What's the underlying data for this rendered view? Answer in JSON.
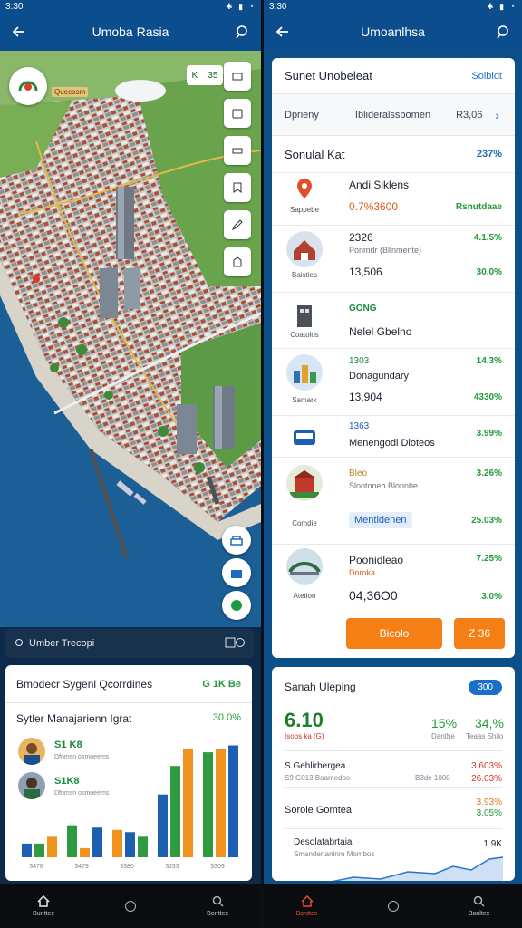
{
  "status": {
    "time_left": "3:30",
    "time_right": "3:30",
    "icons": "✱ ▮ ◔"
  },
  "left": {
    "appbar_title": "Umoba Rasia",
    "map_label": "Quecosm",
    "scale_tag": {
      "a": "K",
      "b": "35"
    },
    "search_text": "Umber Trecopi",
    "card": {
      "title": "Bmodecr Sygenl Qcorrdines",
      "badge": "G 1K Be",
      "subtitle": "Sytler Manajarienn Igrat",
      "subtitle_value": "30.0%",
      "people": [
        {
          "name": "S1 K8",
          "sub": "Dfnmsn osmoeems"
        },
        {
          "name": "S1K8",
          "sub": "Dfnmsn osmoeems"
        }
      ],
      "xticks": [
        "3478",
        "3479",
        "3380",
        "3J33",
        "3309"
      ]
    },
    "nav": {
      "home": "Bunttex",
      "search": "Bonttex"
    }
  },
  "right": {
    "appbar_title": "Umoanlhsa",
    "panel": {
      "title": "Sunet Unobeleat",
      "title_link": "Solbidt",
      "filter_a": "Dprieny",
      "filter_b": "Iblideralssbomen",
      "filter_c": "R3,06",
      "section": "Sonulal Kat",
      "section_pct": "237%",
      "rows": [
        {
          "cap": "Sappebe",
          "l1": "Andi Siklens",
          "l2": "",
          "l3": "0.7%3600",
          "r1": "",
          "r2": "Rsnutdaae"
        },
        {
          "cap": "Baisties",
          "l1": "2326",
          "l2": "Ponmdr (Bllnmente)",
          "l3": "13,506",
          "r1": "4.1.5%",
          "r2": "30.0%"
        },
        {
          "cap": "Coatolos",
          "l1": "GONG",
          "l2": "",
          "l3": "Nelel Gbelno",
          "r1": "",
          "r2": ""
        },
        {
          "cap": "Samark",
          "l1": "1303",
          "l2": "Donagundary",
          "l3": "13,904",
          "r1": "14.3%",
          "r2": "4330%"
        },
        {
          "cap": "",
          "l1": "1363",
          "l2": "",
          "l3": "Menengodl Dioteos",
          "r1": "3.99%",
          "r2": ""
        },
        {
          "cap": "Comdie",
          "l1": "Bleo",
          "l2": "Slootoneb Blonnbe",
          "l3": "Mentldenen",
          "r1": "3.26%",
          "r2": "25.03%"
        },
        {
          "cap": "Atetion",
          "l1": "Poonidleao",
          "l2": "Doroka",
          "l3": "04,36O0",
          "r1": "7.25%",
          "r2": "3.0%"
        }
      ],
      "btn1": "Bicolo",
      "btn2": "Z 36"
    },
    "card": {
      "title": "Sanah Uleping",
      "pill": "300",
      "big": "6.10",
      "big_sub": "Isobs ka (G)",
      "v1": "15%",
      "v1_sub": "Danthe",
      "v2": "34,%",
      "v2_sub": "Teaas Shilo",
      "l1": "S Gehlirbergea",
      "l1_sub": "S9 G013 Boamedos",
      "l1_mid": "B3de 1000",
      "l1_r1": "3.603%",
      "l1_r2": "26.03%",
      "l2": "Sorole Gomtea",
      "l2_r1": "3.93%",
      "l2_r2": "3.05%",
      "l3": "Desolatabrtaia",
      "l3_sub": "Smandertaninm Mombos",
      "l3_r": "1 9K"
    },
    "nav": {
      "home": "Bonttex",
      "search": "Banltex"
    }
  },
  "colors": {
    "appbar": "#0c4d8e",
    "accent_orange": "#f47f14",
    "green": "#239a3b",
    "blue": "#1b6fc4"
  },
  "chart_data": {
    "type": "bar",
    "categories": [
      "3478",
      "3479",
      "3380",
      "3J33",
      "3309"
    ],
    "series": [
      {
        "values": [
          12,
          28,
          24,
          55,
          92
        ]
      },
      {
        "values": [
          12,
          8,
          22,
          80,
          95
        ]
      },
      {
        "values": [
          18,
          26,
          18,
          95,
          98
        ]
      }
    ],
    "ylim": [
      0,
      100
    ]
  }
}
